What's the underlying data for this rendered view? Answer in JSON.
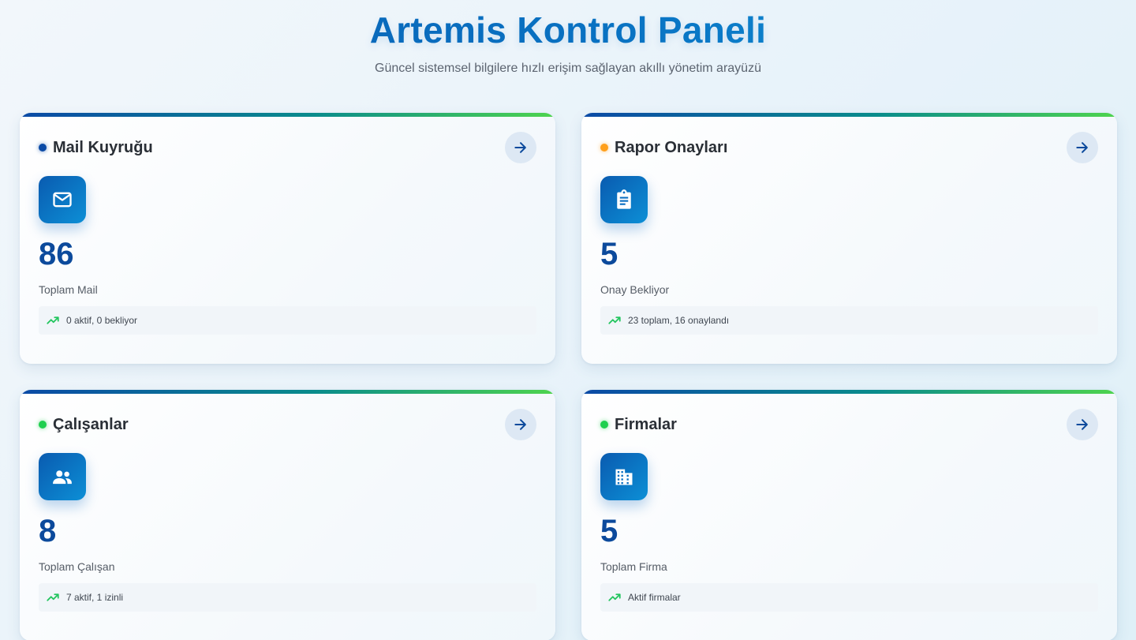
{
  "header": {
    "title": "Artemis Kontrol Paneli",
    "subtitle": "Güncel sistemsel bilgilere hızlı erişim sağlayan akıllı yönetim arayüzü"
  },
  "cards": [
    {
      "title": "Mail Kuyruğu",
      "status_color": "#0b4aa6",
      "icon": "mail-icon",
      "value": "86",
      "label": "Toplam Mail",
      "footer": "0 aktif, 0 bekliyor"
    },
    {
      "title": "Rapor Onayları",
      "status_color": "#ff9f1a",
      "icon": "clipboard-icon",
      "value": "5",
      "label": "Onay Bekliyor",
      "footer": "23 toplam, 16 onaylandı"
    },
    {
      "title": "Çalışanlar",
      "status_color": "#1fcf4f",
      "icon": "people-icon",
      "value": "8",
      "label": "Toplam Çalışan",
      "footer": "7 aktif, 1 izinli"
    },
    {
      "title": "Firmalar",
      "status_color": "#1fcf4f",
      "icon": "building-icon",
      "value": "5",
      "label": "Toplam Firma",
      "footer": "Aktif firmalar"
    }
  ],
  "colors": {
    "accent": "#0b4aa6",
    "trend": "#22c55e"
  }
}
